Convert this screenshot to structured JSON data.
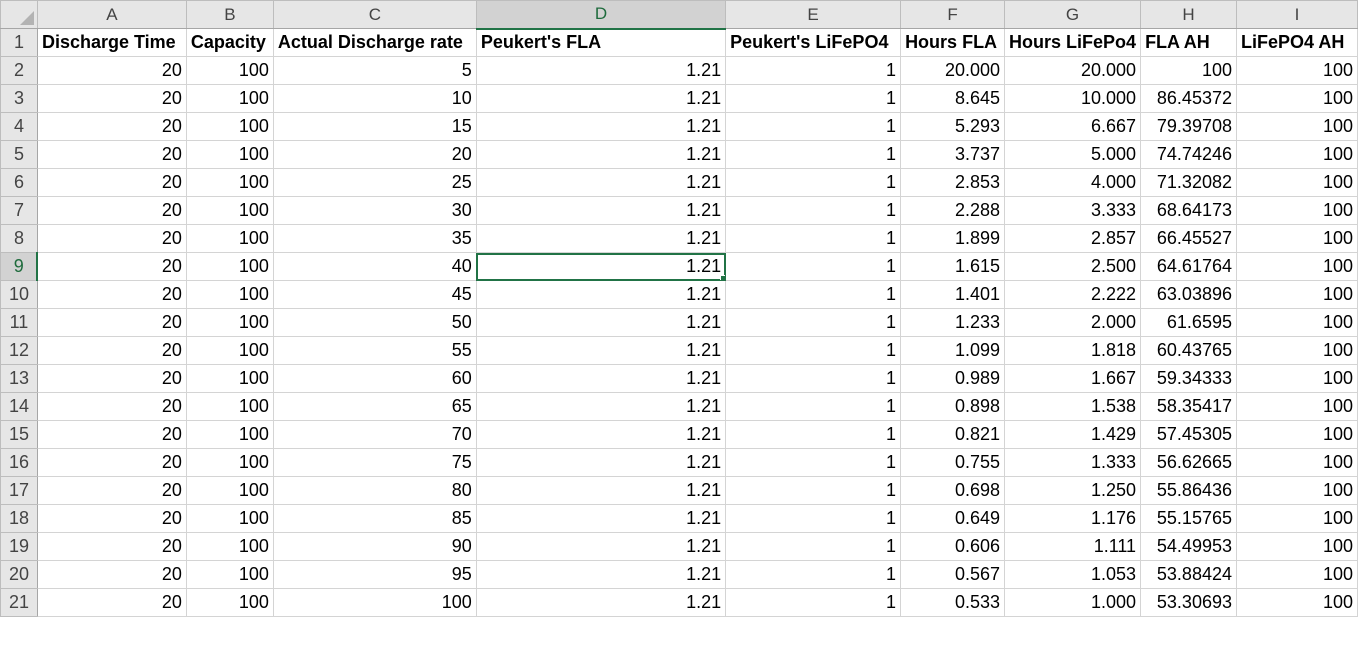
{
  "sheet": {
    "column_letters": [
      "A",
      "B",
      "C",
      "D",
      "E",
      "F",
      "G",
      "H",
      "I"
    ],
    "selected_column": "D",
    "selected_row": 9,
    "active_cell": "D9",
    "accent_color": "#217346",
    "headers": [
      "Discharge Time",
      "Capacity",
      "Actual Discharge rate",
      "Peukert's FLA",
      "Peukert's LiFePO4",
      "Hours FLA",
      "Hours LiFePo4",
      "FLA AH",
      "LiFePO4 AH"
    ],
    "rows": [
      [
        "20",
        "100",
        "5",
        "1.21",
        "1",
        "20.000",
        "20.000",
        "100",
        "100"
      ],
      [
        "20",
        "100",
        "10",
        "1.21",
        "1",
        "8.645",
        "10.000",
        "86.45372",
        "100"
      ],
      [
        "20",
        "100",
        "15",
        "1.21",
        "1",
        "5.293",
        "6.667",
        "79.39708",
        "100"
      ],
      [
        "20",
        "100",
        "20",
        "1.21",
        "1",
        "3.737",
        "5.000",
        "74.74246",
        "100"
      ],
      [
        "20",
        "100",
        "25",
        "1.21",
        "1",
        "2.853",
        "4.000",
        "71.32082",
        "100"
      ],
      [
        "20",
        "100",
        "30",
        "1.21",
        "1",
        "2.288",
        "3.333",
        "68.64173",
        "100"
      ],
      [
        "20",
        "100",
        "35",
        "1.21",
        "1",
        "1.899",
        "2.857",
        "66.45527",
        "100"
      ],
      [
        "20",
        "100",
        "40",
        "1.21",
        "1",
        "1.615",
        "2.500",
        "64.61764",
        "100"
      ],
      [
        "20",
        "100",
        "45",
        "1.21",
        "1",
        "1.401",
        "2.222",
        "63.03896",
        "100"
      ],
      [
        "20",
        "100",
        "50",
        "1.21",
        "1",
        "1.233",
        "2.000",
        "61.6595",
        "100"
      ],
      [
        "20",
        "100",
        "55",
        "1.21",
        "1",
        "1.099",
        "1.818",
        "60.43765",
        "100"
      ],
      [
        "20",
        "100",
        "60",
        "1.21",
        "1",
        "0.989",
        "1.667",
        "59.34333",
        "100"
      ],
      [
        "20",
        "100",
        "65",
        "1.21",
        "1",
        "0.898",
        "1.538",
        "58.35417",
        "100"
      ],
      [
        "20",
        "100",
        "70",
        "1.21",
        "1",
        "0.821",
        "1.429",
        "57.45305",
        "100"
      ],
      [
        "20",
        "100",
        "75",
        "1.21",
        "1",
        "0.755",
        "1.333",
        "56.62665",
        "100"
      ],
      [
        "20",
        "100",
        "80",
        "1.21",
        "1",
        "0.698",
        "1.250",
        "55.86436",
        "100"
      ],
      [
        "20",
        "100",
        "85",
        "1.21",
        "1",
        "0.649",
        "1.176",
        "55.15765",
        "100"
      ],
      [
        "20",
        "100",
        "90",
        "1.21",
        "1",
        "0.606",
        "1.111",
        "54.49953",
        "100"
      ],
      [
        "20",
        "100",
        "95",
        "1.21",
        "1",
        "0.567",
        "1.053",
        "53.88424",
        "100"
      ],
      [
        "20",
        "100",
        "100",
        "1.21",
        "1",
        "0.533",
        "1.000",
        "53.30693",
        "100"
      ]
    ]
  }
}
